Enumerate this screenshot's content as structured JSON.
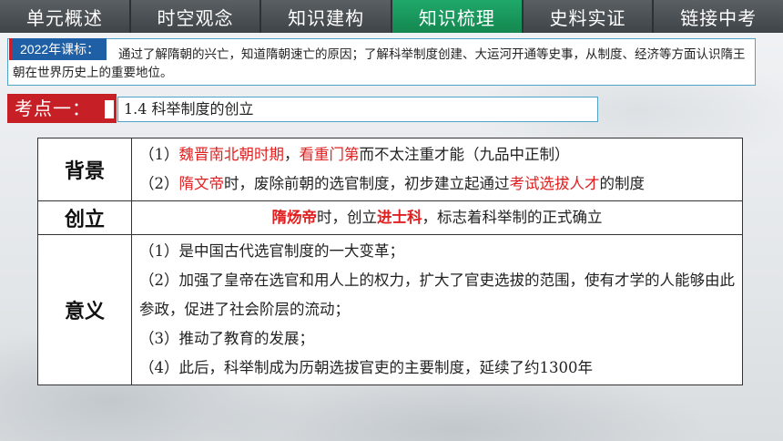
{
  "tabs": [
    {
      "label": "单元概述",
      "active": false
    },
    {
      "label": "时空观念",
      "active": false
    },
    {
      "label": "知识建构",
      "active": false
    },
    {
      "label": "知识梳理",
      "active": true
    },
    {
      "label": "史料实证",
      "active": false
    },
    {
      "label": "链接中考",
      "active": false
    }
  ],
  "standard": {
    "badge": "2022年课标：",
    "text": "通过了解隋朝的兴亡，知道隋朝速亡的原因；了解科举制度创建、大运河开通等史事，从制度、经济等方面认识隋王朝在世界历史上的重要地位。"
  },
  "kaodian": {
    "label": "考点一：",
    "title": "1.4 科举制度的创立"
  },
  "table": {
    "background": {
      "head": "背景",
      "l1_a": "（1）",
      "l1_red1": "魏晋南北朝时期",
      "l1_b": "，",
      "l1_red2": "看重门第",
      "l1_c": "而不太注重才能（九品中正制）",
      "l2_a": "（2）",
      "l2_red1": "隋文帝",
      "l2_b": "时，废除前朝的选官制度，初步建立起通过",
      "l2_red2": "考试选拔人才",
      "l2_c": "的制度"
    },
    "founding": {
      "head": "创立",
      "red1": "隋炀帝",
      "a": "时，创立",
      "red2": "进士科",
      "b": "，标志着科举制的正式确立"
    },
    "significance": {
      "head": "意义",
      "items": [
        "（1）是中国古代选官制度的一大变革；",
        "（2）加强了皇帝在选官和用人上的权力，扩大了官吏选拔的范围，使有才学的人能够由此参政，促进了社会阶层的流动；",
        "（3）推动了教育的发展；",
        "（4）此后，科举制成为历朝选拔官吏的主要制度，延续了约1300年"
      ]
    }
  }
}
